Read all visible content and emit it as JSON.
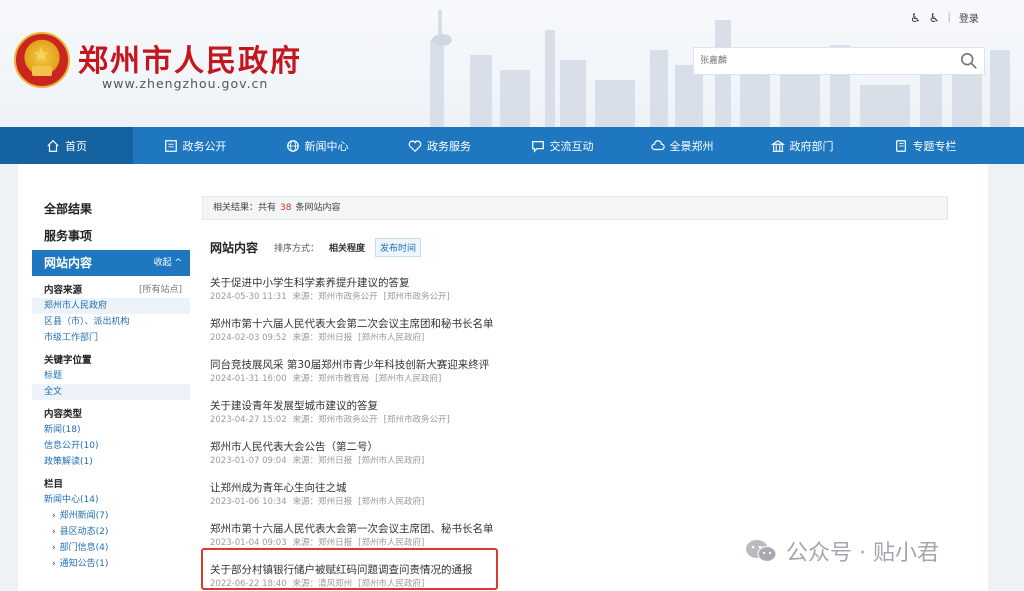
{
  "header": {
    "site_title": "郑州市人民政府",
    "site_url": "www.zhengzhou.gov.cn",
    "top_links": {
      "accessibility": "♿",
      "separator": "|",
      "login": "登录"
    },
    "search": {
      "placeholder": "张嘉麟"
    }
  },
  "nav": {
    "items": [
      {
        "label": "首页",
        "icon": "home-icon"
      },
      {
        "label": "政务公开",
        "icon": "document-icon"
      },
      {
        "label": "新闻中心",
        "icon": "globe-icon"
      },
      {
        "label": "政务服务",
        "icon": "heart-icon"
      },
      {
        "label": "交流互动",
        "icon": "chat-icon"
      },
      {
        "label": "全景郑州",
        "icon": "cloud-icon"
      },
      {
        "label": "政府部门",
        "icon": "building-icon"
      },
      {
        "label": "专题专栏",
        "icon": "book-icon"
      }
    ]
  },
  "sidebar": {
    "all_results": "全部结果",
    "services": "服务事项",
    "website_content": "网站内容",
    "collapse": "收起 ^",
    "source_label": "内容来源",
    "source_extra": "[所有站点]",
    "sources": [
      "郑州市人民政府",
      "区县（市）、派出机构",
      "市级工作部门"
    ],
    "keyword_label": "关键字位置",
    "keywords": [
      "标题",
      "全文"
    ],
    "type_label": "内容类型",
    "types": [
      "新闻(18)",
      "信息公开(10)",
      "政策解读(1)"
    ],
    "column_label": "栏目",
    "columns": [
      "新闻中心(14)"
    ],
    "subcolumns": [
      "郑州新闻(7)",
      "县区动态(2)",
      "部门信息(4)",
      "通知公告(1)"
    ]
  },
  "main": {
    "result_prefix": "相关结果：共有",
    "result_count": "38",
    "result_suffix": "条网站内容",
    "section_title": "网站内容",
    "sort_label": "排序方式：",
    "sort_relevance": "相关程度",
    "sort_date": "发布时间",
    "results": [
      {
        "title": "关于促进中小学生科学素养提升建议的答复",
        "date": "2024-05-30 11:31",
        "source": "来源：郑州市政务公开",
        "site": "[郑州市政务公开]"
      },
      {
        "title": "郑州市第十六届人民代表大会第二次会议主席团和秘书长名单",
        "date": "2024-02-03 09:52",
        "source": "来源：郑州日报",
        "site": "[郑州市人民政府]"
      },
      {
        "title": "同台竞技展风采 第30届郑州市青少年科技创新大赛迎来终评",
        "date": "2024-01-31 16:00",
        "source": "来源：郑州市教育局",
        "site": "[郑州市人民政府]"
      },
      {
        "title": "关于建设青年发展型城市建议的答复",
        "date": "2023-04-27 15:02",
        "source": "来源：郑州市政务公开",
        "site": "[郑州市政务公开]"
      },
      {
        "title": "郑州市人民代表大会公告（第二号）",
        "date": "2023-01-07 09:04",
        "source": "来源：郑州日报",
        "site": "[郑州市人民政府]"
      },
      {
        "title": "让郑州成为青年心生向往之城",
        "date": "2023-01-06 10:34",
        "source": "来源：郑州日报",
        "site": "[郑州市人民政府]"
      },
      {
        "title": "郑州市第十六届人民代表大会第一次会议主席团、秘书长名单",
        "date": "2023-01-04 09:03",
        "source": "来源：郑州日报",
        "site": "[郑州市人民政府]"
      },
      {
        "title": "关于部分村镇银行储户被赋红码问题调查问责情况的通报",
        "date": "2022-06-22 18:40",
        "source": "来源：清风郑州",
        "site": "[郑州市人民政府]"
      }
    ]
  },
  "watermark": {
    "text": "公众号 · 贴小君"
  },
  "colors": {
    "nav_blue": "#1f78bf",
    "brand_red": "#c4161c",
    "highlight_red": "#d93a2b"
  }
}
